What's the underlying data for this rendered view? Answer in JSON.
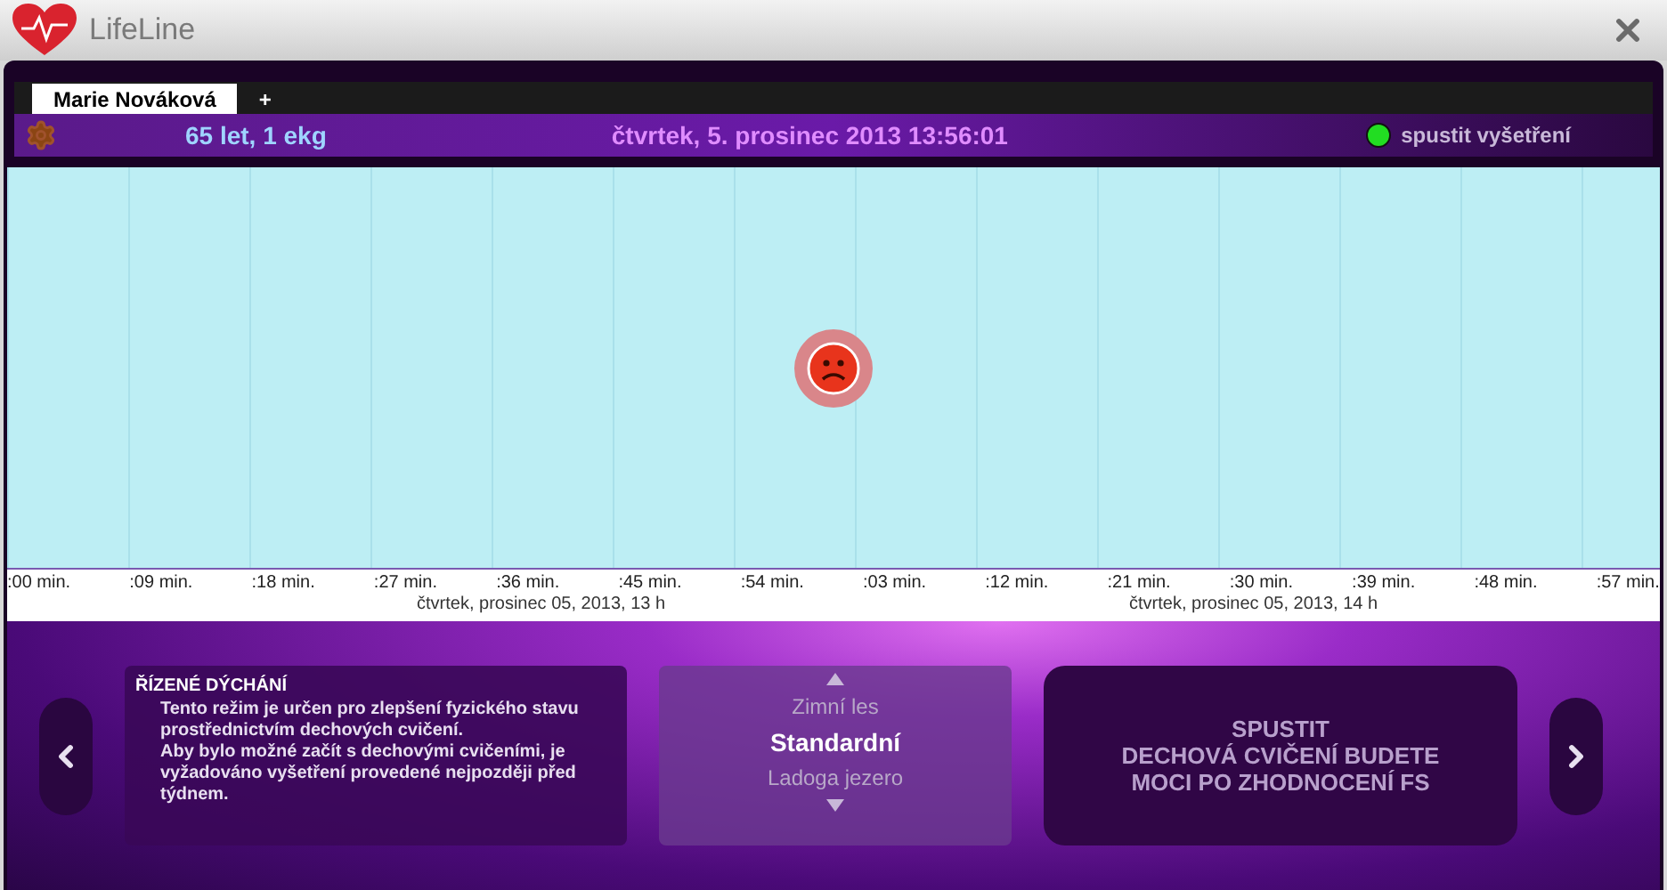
{
  "window": {
    "title": "LifeLine"
  },
  "tabs": [
    {
      "label": "Marie Nováková",
      "selected": true
    }
  ],
  "add_tab": "+",
  "info_bar": {
    "patient": "65 let, 1 ekg",
    "datetime": "čtvrtek, 5. prosinec 2013 13:56:01",
    "status": {
      "label": "spustit vyšetření",
      "on": true
    }
  },
  "timeline": {
    "ticks": [
      ":00 min.",
      ":09 min.",
      ":18 min.",
      ":27 min.",
      ":36 min.",
      ":45 min.",
      ":54 min.",
      ":03 min.",
      ":12 min.",
      ":21 min.",
      ":30 min.",
      ":39 min.",
      ":48 min.",
      ":57 min."
    ],
    "dates": [
      "čtvrtek, prosinec 05, 2013, 13 h",
      "čtvrtek, prosinec 05, 2013, 14 h"
    ]
  },
  "mode": {
    "title": "ŘÍZENÉ DÝCHÁNÍ",
    "description": "Tento režim je určen pro zlepšení fyzického stavu prostřednictvím dechových cvičení.\nAby bylo možné začít s dechovými cvičeními, je vyžadováno vyšetření provedené nejpozději před týdnem."
  },
  "programs": [
    {
      "label": "Zimní les",
      "selected": false
    },
    {
      "label": "Standardní",
      "selected": true
    },
    {
      "label": "Ladoga jezero",
      "selected": false
    }
  ],
  "start_button": {
    "label": "SPUSTIT\nDECHOVÁ CVIČENÍ BUDETE\nMOCI PO ZHODNOCENÍ FS",
    "disabled": true
  }
}
